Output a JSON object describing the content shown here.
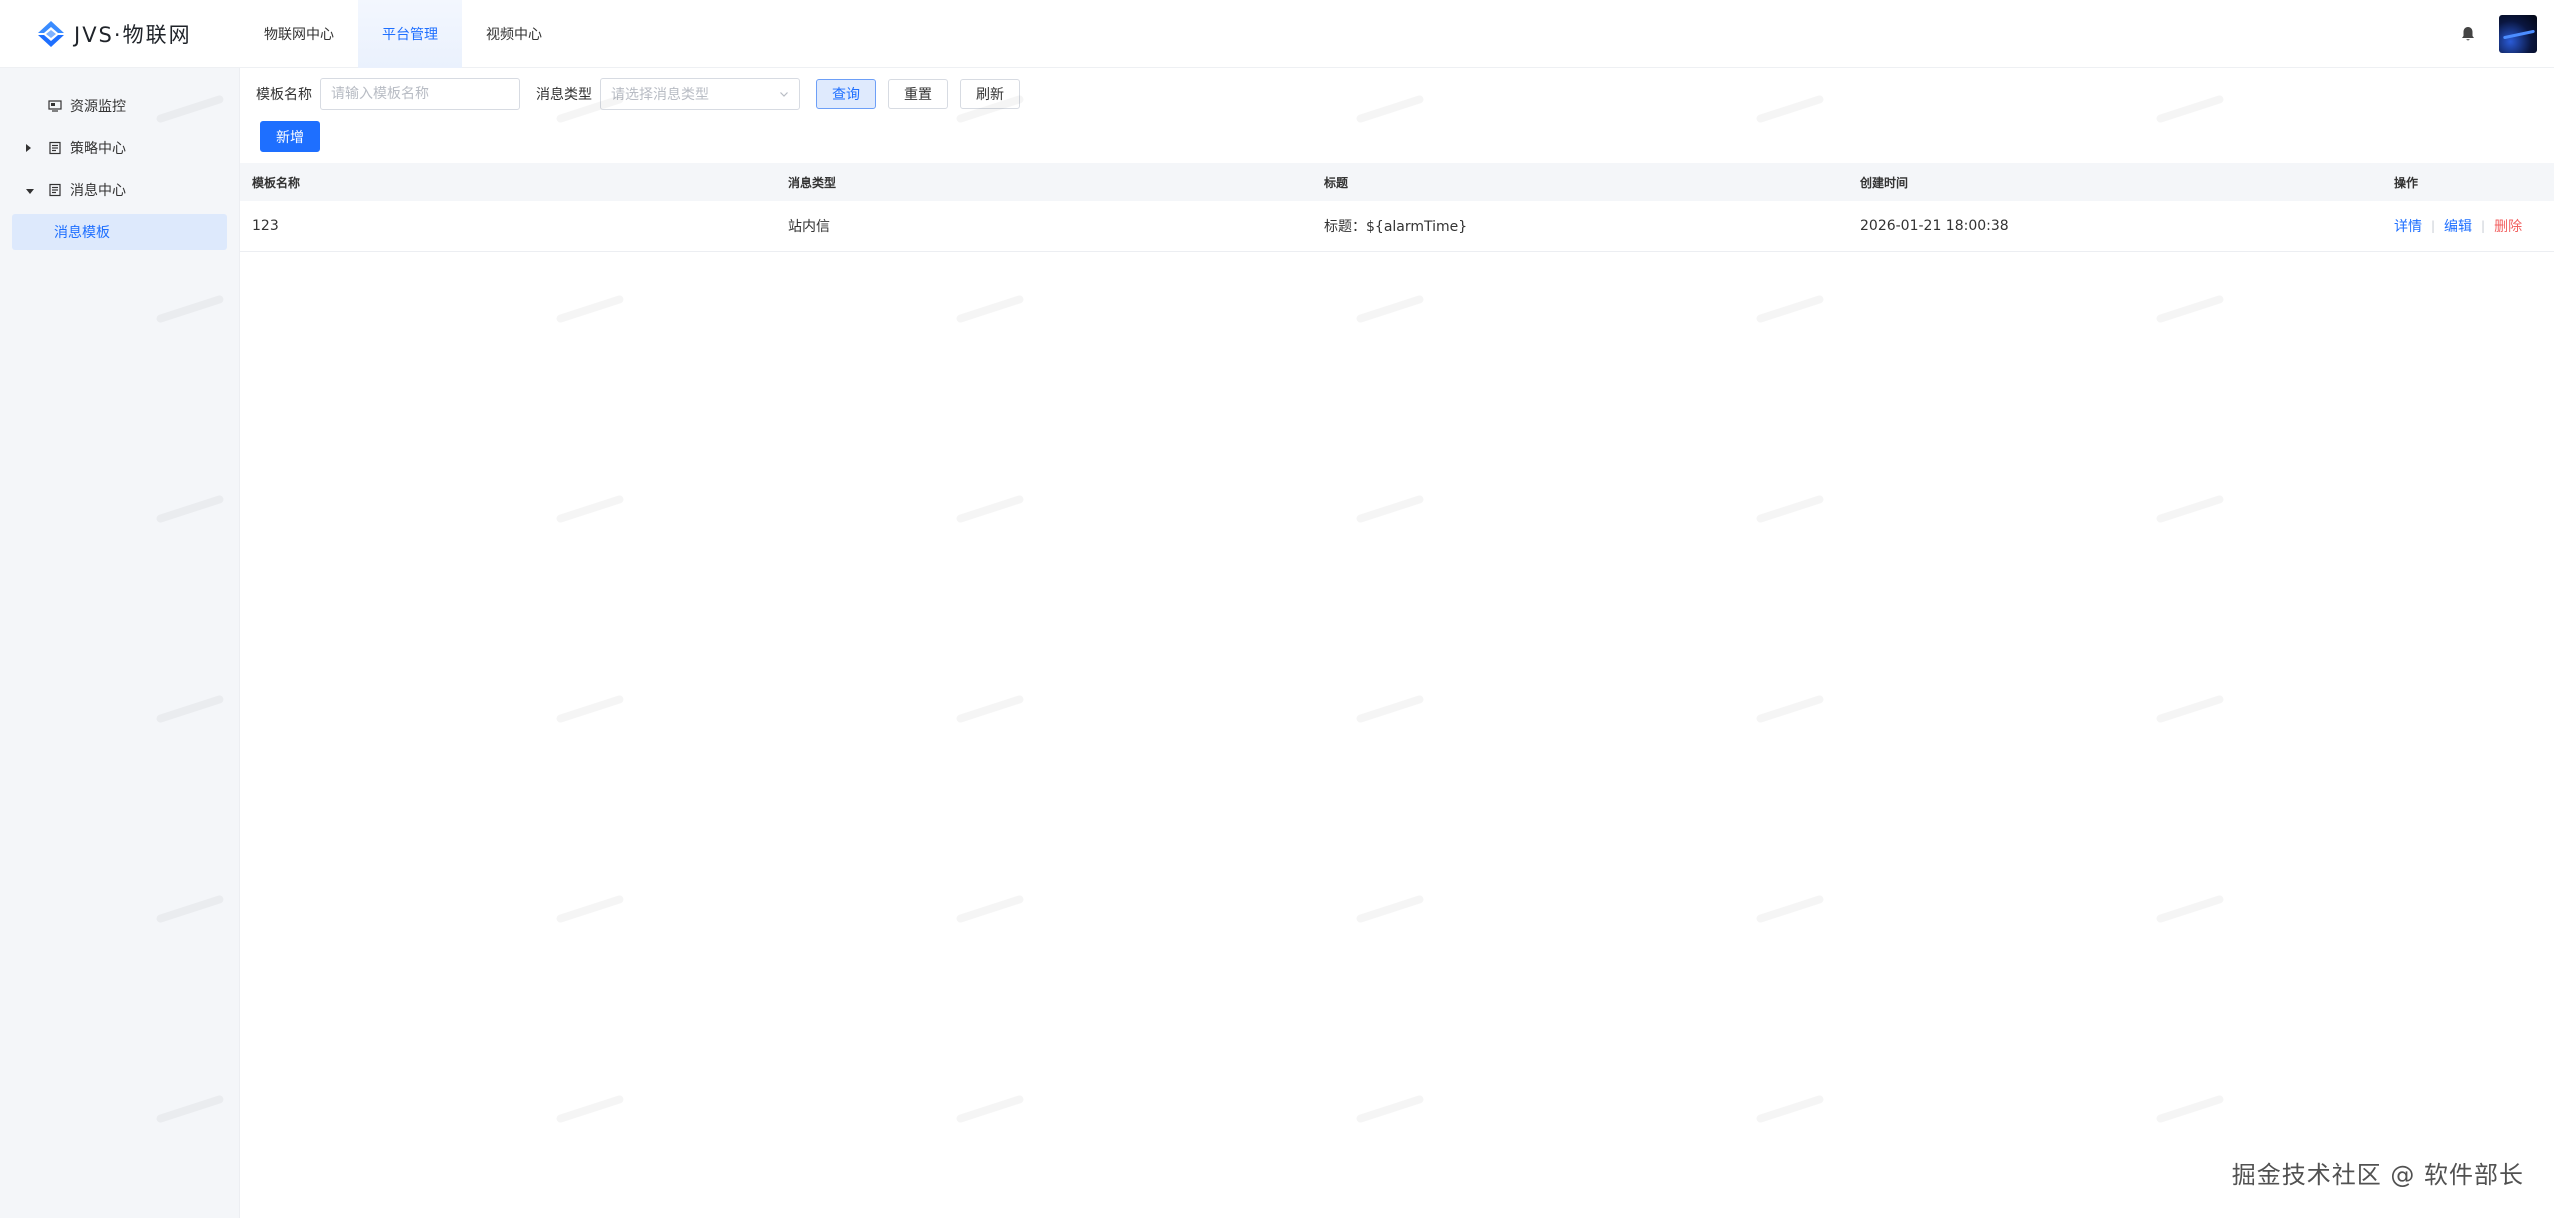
{
  "header": {
    "logo_text": "JVS·物联网",
    "tabs": [
      {
        "label": "物联网中心",
        "active": false
      },
      {
        "label": "平台管理",
        "active": true
      },
      {
        "label": "视频中心",
        "active": false
      }
    ]
  },
  "sidebar": {
    "items": [
      {
        "label": "资源监控",
        "icon": "monitor-icon",
        "caret": "none"
      },
      {
        "label": "策略中心",
        "icon": "strategy-icon",
        "caret": "collapsed"
      },
      {
        "label": "消息中心",
        "icon": "message-icon",
        "caret": "expanded"
      },
      {
        "label": "消息模板",
        "icon": "",
        "caret": "none",
        "selected": true
      }
    ]
  },
  "filter": {
    "name_label": "模板名称",
    "name_placeholder": "请输入模板名称",
    "type_label": "消息类型",
    "type_placeholder": "请选择消息类型",
    "query_label": "查询",
    "reset_label": "重置",
    "refresh_label": "刷新"
  },
  "add_button_label": "新增",
  "table": {
    "columns": [
      "模板名称",
      "消息类型",
      "标题",
      "创建时间",
      "操作"
    ],
    "rows": [
      {
        "name": "123",
        "type": "站内信",
        "title": "标题：${alarmTime}",
        "created": "2026-01-21 18:00:38",
        "ops": {
          "detail": "详情",
          "edit": "编辑",
          "delete": "删除"
        }
      }
    ]
  },
  "footer_text": "掘金技术社区 @ 软件部长",
  "colors": {
    "primary": "#1e6fff",
    "danger": "#f26060",
    "selected_bg": "#dde9fc"
  }
}
